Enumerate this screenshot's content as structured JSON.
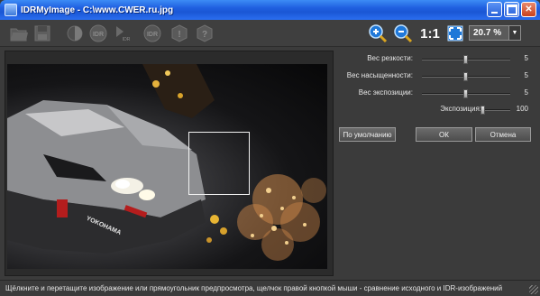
{
  "window": {
    "title": "IDRMyImage - C:\\www.CWER.ru.jpg"
  },
  "toolbar": {
    "icons": [
      "open-folder-icon",
      "save-disk-icon",
      "half-circle-icon",
      "idr-icon",
      "idr-small-icon",
      "idr-gear-icon",
      "info-icon",
      "settings-icon",
      "zoom-in-icon",
      "zoom-out-icon",
      "actual-size-label",
      "fit-window-icon"
    ],
    "actual_size_label": "1:1",
    "zoom_value": "20.7 %"
  },
  "sliders": [
    {
      "label": "Вес резкости:",
      "value": "5",
      "position": 0.5
    },
    {
      "label": "Вес насыщенности:",
      "value": "5",
      "position": 0.5
    },
    {
      "label": "Вес экспозиции:",
      "value": "5",
      "position": 0.5
    },
    {
      "label": "Экспозиция:",
      "value": "100",
      "position": 0.5
    }
  ],
  "buttons": {
    "default": "По умолчанию",
    "ok": "ОК",
    "cancel": "Отмена"
  },
  "status": {
    "text": "Щёлкните и перетащите изображение или прямоугольник предпросмотра, щелчок правой кнопкой мыши - сравнение исходного и IDR-изображений"
  },
  "colors": {
    "titlebar": "#1f5fe0",
    "panel": "#3b3b3b",
    "accent_icons": "#2a8de0"
  }
}
